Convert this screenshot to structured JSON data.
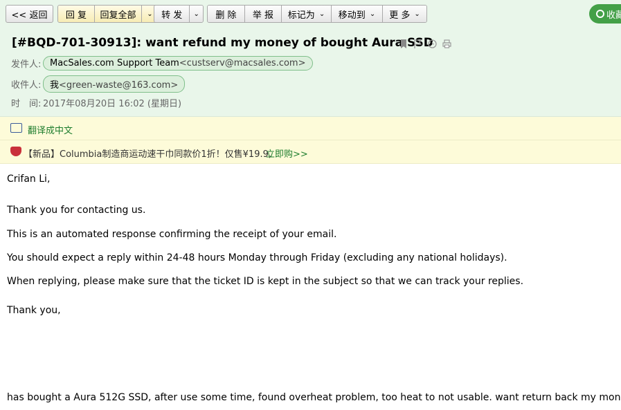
{
  "toolbar": {
    "back": "<< 返回",
    "reply": "回 复",
    "reply_all": "回复全部",
    "forward": "转 发",
    "delete": "删 除",
    "report": "举 报",
    "mark_as": "标记为",
    "move_to": "移动到",
    "more": "更 多",
    "favorite": "收藏"
  },
  "email": {
    "subject": "[#BQD-701-30913]: want refund my money of bought Aura SSD",
    "from_label": "发件人:",
    "from_name": "MacSales.com Support Team",
    "from_addr": "<custserv@macsales.com>",
    "to_label": "收件人:",
    "to_name": "我",
    "to_addr": "<green-waste@163.com>",
    "time_label": "时　间:",
    "time_value": "2017年08月20日 16:02 (星期日)"
  },
  "translate": {
    "label": "翻译成中文"
  },
  "promo": {
    "text": "【新品】Columbia制造商运动速干巾同款价1折！仅售¥19.9,",
    "link": "立即购>>"
  },
  "body": {
    "greeting": "Crifan Li,",
    "line1": "Thank you for contacting us.",
    "line2": "This is an automated response confirming the receipt of your email.",
    "line3": "You should expect a reply within 24-48 hours Monday through Friday (excluding any national holidays).",
    "line4": "When replying, please make sure that the ticket ID is kept in the subject so that we can track your replies.",
    "signoff": "Thank you,",
    "quoted": "has bought a Aura 512G SSD, after use some time, found overheat problem, too heat to not usable. want return back my money!"
  }
}
